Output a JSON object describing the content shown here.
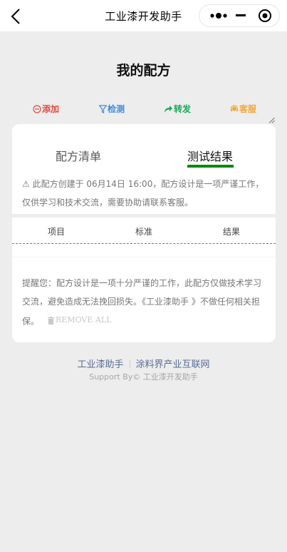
{
  "navbar": {
    "title": "工业漆开发助手"
  },
  "page": {
    "title": "我的配方"
  },
  "actions": {
    "add": "添加",
    "detect": "检测",
    "share": "转发",
    "service": "客服"
  },
  "tabs": {
    "recipe_list": "配方清单",
    "test_result": "测试结果",
    "active": "test_result"
  },
  "notice": "⚠ 此配方创建于 06月14日 16:00，配方设计是一项严谨工作，仅供学习和技术交流，需要协助请联系客服。",
  "table": {
    "headers": [
      "项目",
      "标准",
      "结果"
    ]
  },
  "reminder": {
    "text": "提醒您：配方设计是一项十分严谨的工作，此配方仅做技术学习交流，避免造成无法挽回损失。《工业漆助手 》不做任何相关担保。",
    "remove_all": "REMOVE ALL"
  },
  "footer": {
    "links": [
      "工业漆助手",
      "涂料界产业互联网"
    ],
    "support": "Support By© 工业漆开发助手"
  },
  "colors": {
    "add": "#e5483d",
    "detect": "#3b8ae0",
    "share": "#1aa85a",
    "service": "#f2a63a",
    "tab_active_underline": "#0b8a0b",
    "footer_link": "#586c94"
  }
}
